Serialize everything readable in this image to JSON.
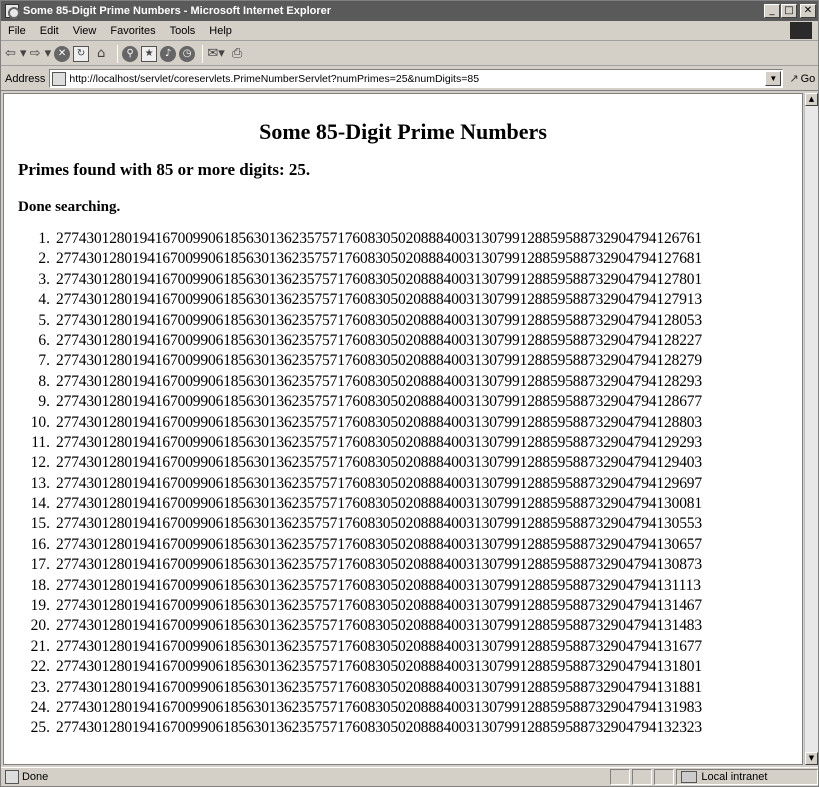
{
  "window": {
    "title": "Some 85-Digit Prime Numbers - Microsoft Internet Explorer",
    "controls": {
      "minimize": "_",
      "maximize": "□",
      "close": "✕"
    }
  },
  "menu": {
    "items": [
      "File",
      "Edit",
      "View",
      "Favorites",
      "Tools",
      "Help"
    ]
  },
  "toolbar": {
    "buttons": [
      "back-icon",
      "forward-icon",
      "stop-icon",
      "refresh-icon",
      "home-icon",
      "search-icon",
      "favorites-icon",
      "history-icon",
      "mail-icon",
      "print-icon"
    ]
  },
  "address": {
    "label": "Address",
    "url": "http://localhost/servlet/coreservlets.PrimeNumberServlet?numPrimes=25&numDigits=85",
    "go_label": "Go"
  },
  "page": {
    "heading": "Some 85-Digit Prime Numbers",
    "summary": "Primes found with 85 or more digits: 25.",
    "done": "Done searching.",
    "primes": [
      {
        "n": "1.",
        "v": "2774301280194167009906185630136235757176083050208884003130799128859588732904794126761"
      },
      {
        "n": "2.",
        "v": "2774301280194167009906185630136235757176083050208884003130799128859588732904794127681"
      },
      {
        "n": "3.",
        "v": "2774301280194167009906185630136235757176083050208884003130799128859588732904794127801"
      },
      {
        "n": "4.",
        "v": "2774301280194167009906185630136235757176083050208884003130799128859588732904794127913"
      },
      {
        "n": "5.",
        "v": "2774301280194167009906185630136235757176083050208884003130799128859588732904794128053"
      },
      {
        "n": "6.",
        "v": "2774301280194167009906185630136235757176083050208884003130799128859588732904794128227"
      },
      {
        "n": "7.",
        "v": "2774301280194167009906185630136235757176083050208884003130799128859588732904794128279"
      },
      {
        "n": "8.",
        "v": "2774301280194167009906185630136235757176083050208884003130799128859588732904794128293"
      },
      {
        "n": "9.",
        "v": "2774301280194167009906185630136235757176083050208884003130799128859588732904794128677"
      },
      {
        "n": "10.",
        "v": "2774301280194167009906185630136235757176083050208884003130799128859588732904794128803"
      },
      {
        "n": "11.",
        "v": "2774301280194167009906185630136235757176083050208884003130799128859588732904794129293"
      },
      {
        "n": "12.",
        "v": "2774301280194167009906185630136235757176083050208884003130799128859588732904794129403"
      },
      {
        "n": "13.",
        "v": "2774301280194167009906185630136235757176083050208884003130799128859588732904794129697"
      },
      {
        "n": "14.",
        "v": "2774301280194167009906185630136235757176083050208884003130799128859588732904794130081"
      },
      {
        "n": "15.",
        "v": "2774301280194167009906185630136235757176083050208884003130799128859588732904794130553"
      },
      {
        "n": "16.",
        "v": "2774301280194167009906185630136235757176083050208884003130799128859588732904794130657"
      },
      {
        "n": "17.",
        "v": "2774301280194167009906185630136235757176083050208884003130799128859588732904794130873"
      },
      {
        "n": "18.",
        "v": "2774301280194167009906185630136235757176083050208884003130799128859588732904794131113"
      },
      {
        "n": "19.",
        "v": "2774301280194167009906185630136235757176083050208884003130799128859588732904794131467"
      },
      {
        "n": "20.",
        "v": "2774301280194167009906185630136235757176083050208884003130799128859588732904794131483"
      },
      {
        "n": "21.",
        "v": "2774301280194167009906185630136235757176083050208884003130799128859588732904794131677"
      },
      {
        "n": "22.",
        "v": "2774301280194167009906185630136235757176083050208884003130799128859588732904794131801"
      },
      {
        "n": "23.",
        "v": "2774301280194167009906185630136235757176083050208884003130799128859588732904794131881"
      },
      {
        "n": "24.",
        "v": "2774301280194167009906185630136235757176083050208884003130799128859588732904794131983"
      },
      {
        "n": "25.",
        "v": "2774301280194167009906185630136235757176083050208884003130799128859588732904794132323"
      }
    ]
  },
  "status": {
    "text": "Done",
    "zone": "Local intranet"
  }
}
